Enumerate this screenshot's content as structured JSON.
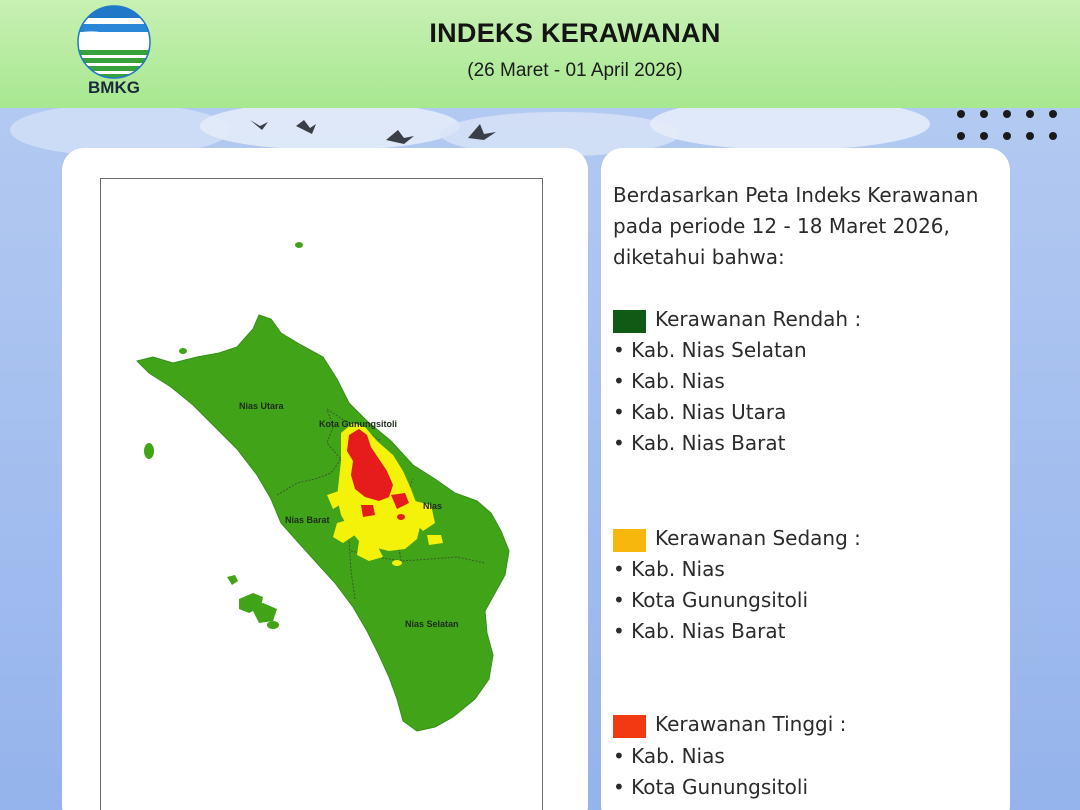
{
  "header": {
    "logo_text": "BMKG",
    "title": "INDEKS KERAWANAN",
    "subtitle": "(26 Maret - 01 April 2026)"
  },
  "map": {
    "type": "choropleth",
    "region_labels": {
      "nias_utara": "Nias Utara",
      "kota_gunungsitoli": "Kota Gunungsitoli",
      "nias_barat": "Nias Barat",
      "nias": "Nias",
      "nias_selatan": "Nias Selatan"
    },
    "colors": {
      "rendah": "#41a317",
      "sedang": "#f5f20a",
      "tinggi": "#e61b1b",
      "boundary": "#3c5a2a"
    }
  },
  "summary": {
    "intro_line1": "Berdasarkan Peta Indeks Kerawanan",
    "intro_line2": "pada periode 12 - 18 Maret 2026,",
    "intro_line3": "diketahui bahwa:"
  },
  "legend": {
    "rendah": {
      "label": "Kerawanan Rendah :",
      "color": "#0f5a14",
      "items": [
        "• Kab. Nias Selatan",
        "• Kab. Nias",
        "• Kab. Nias Utara",
        "• Kab. Nias Barat"
      ]
    },
    "sedang": {
      "label": "Kerawanan Sedang :",
      "color": "#f7b70d",
      "items": [
        "• Kab. Nias",
        "• Kota Gunungsitoli",
        "• Kab. Nias Barat"
      ]
    },
    "tinggi": {
      "label": "Kerawanan Tinggi :",
      "color": "#f23a12",
      "items": [
        "• Kab. Nias",
        "• Kota Gunungsitoli"
      ]
    }
  }
}
